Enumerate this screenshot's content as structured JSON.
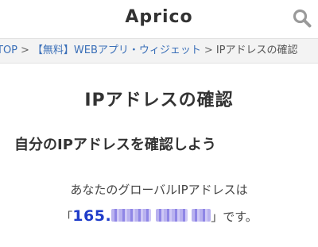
{
  "header": {
    "site_title": "Aprico",
    "search_icon": "search-icon"
  },
  "breadcrumb": {
    "items": [
      "TOP",
      "【無料】WEBアプリ・ウィジェット",
      "IPアドレスの確認"
    ],
    "separator": ">"
  },
  "main": {
    "page_title": "IPアドレスの確認",
    "section_heading": "自分のIPアドレスを確認しよう",
    "ip_label": "あなたのグローバルIPアドレスは",
    "ip_open_bracket": "「",
    "ip_prefix": "165.",
    "ip_suffix": "」です。"
  },
  "colors": {
    "link": "#3a6fb8",
    "ip_value": "#1f3cc9",
    "breadcrumb_bg": "#f3f3f3"
  }
}
